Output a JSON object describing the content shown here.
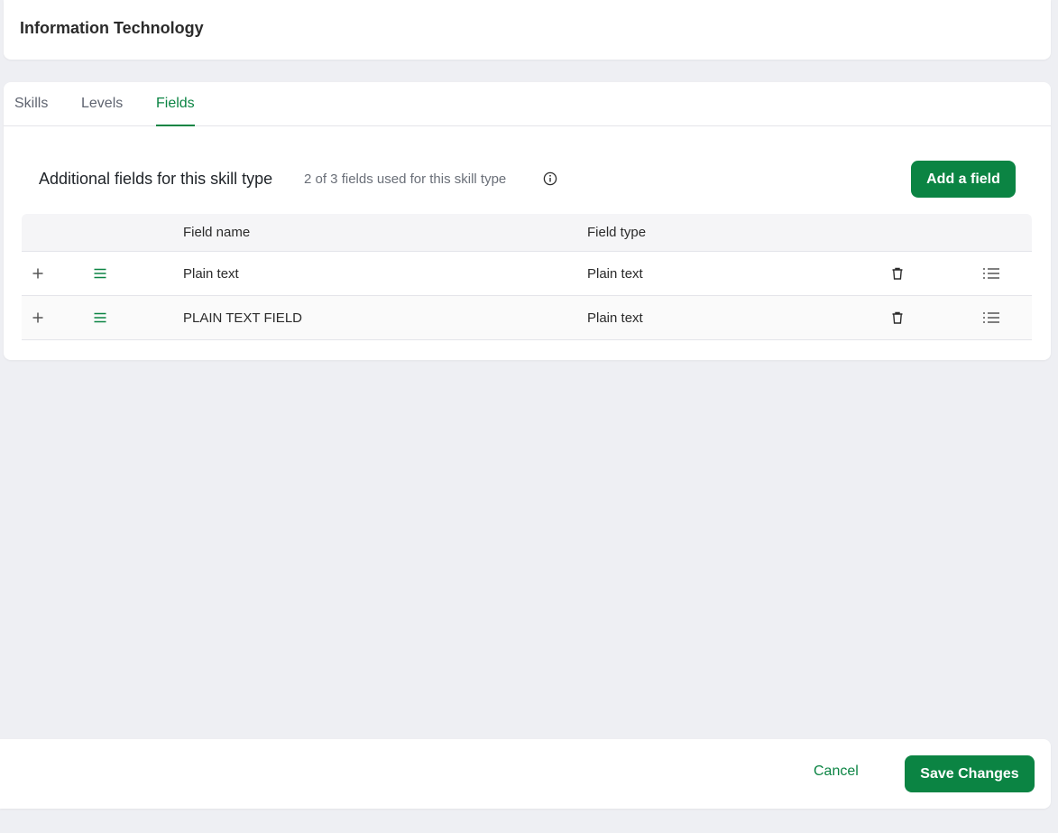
{
  "header": {
    "title": "Information Technology"
  },
  "tabs": [
    {
      "label": "Skills",
      "active": false
    },
    {
      "label": "Levels",
      "active": false
    },
    {
      "label": "Fields",
      "active": true
    }
  ],
  "section": {
    "title": "Additional fields for this skill type",
    "subtitle": "2 of 3 fields used for this skill type",
    "add_button": "Add a field"
  },
  "table": {
    "columns": [
      "Field name",
      "Field type"
    ],
    "rows": [
      {
        "name": "Plain text",
        "type": "Plain text"
      },
      {
        "name": "PLAIN TEXT FIELD",
        "type": "Plain text"
      }
    ]
  },
  "footer": {
    "cancel": "Cancel",
    "save": "Save Changes"
  },
  "colors": {
    "accent": "#0b8443",
    "background": "#eeeff3"
  }
}
